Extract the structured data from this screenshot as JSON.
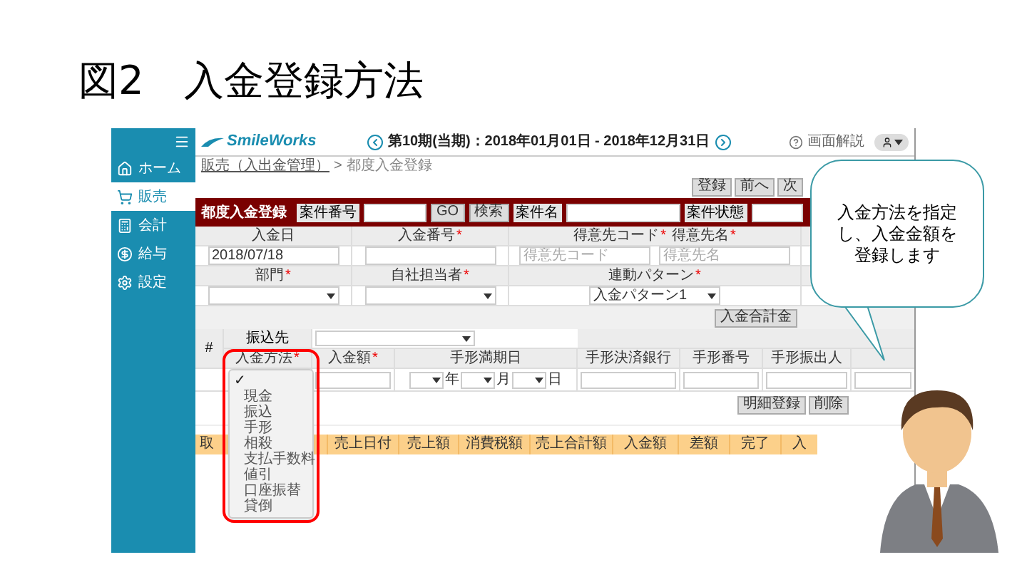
{
  "slide_title": "図2　入金登録方法",
  "required_mark": "*",
  "sidebar": {
    "items": [
      {
        "label": "ホーム",
        "selected": false
      },
      {
        "label": "販売",
        "selected": true
      },
      {
        "label": "会計",
        "selected": false
      },
      {
        "label": "給与",
        "selected": false
      },
      {
        "label": "設定",
        "selected": false
      }
    ]
  },
  "header": {
    "logo": "SmileWorks",
    "period": "第10期(当期)：2018年01月01日 - 2018年12月31日",
    "help": "画面解説"
  },
  "breadcrumb": {
    "link": "販売（入出金管理）",
    "separator": ">",
    "current": "都度入金登録"
  },
  "top_buttons": [
    "登録",
    "前へ",
    "次"
  ],
  "title_bar": {
    "title": "都度入金登録",
    "case_number_label": "案件番号",
    "go_button": "GO",
    "search_button": "検索",
    "case_name_label": "案件名",
    "case_status_label": "案件状態"
  },
  "form": {
    "rows": [
      {
        "cells": [
          {
            "labels": [
              {
                "text": "入金日",
                "required": false
              }
            ],
            "inputs": [
              {
                "kind": "text",
                "value": "2018/07/18"
              }
            ]
          },
          {
            "labels": [
              {
                "text": "入金番号",
                "required": true
              }
            ],
            "inputs": [
              {
                "kind": "text"
              }
            ]
          },
          {
            "labels": [
              {
                "text": "得意先コード",
                "required": true
              },
              {
                "text": "得意先名",
                "required": true
              }
            ],
            "inputs": [
              {
                "kind": "text",
                "placeholder": "得意先コード"
              },
              {
                "kind": "text",
                "placeholder": "得意先名"
              }
            ]
          }
        ]
      },
      {
        "cells": [
          {
            "labels": [
              {
                "text": "部門",
                "required": true
              }
            ],
            "inputs": [
              {
                "kind": "select"
              }
            ]
          },
          {
            "labels": [
              {
                "text": "自社担当者",
                "required": true
              }
            ],
            "inputs": [
              {
                "kind": "select"
              }
            ]
          },
          {
            "labels": [
              {
                "text": "連動パターン",
                "required": true
              }
            ],
            "inputs": [
              {
                "kind": "select",
                "value": "入金パターン1"
              }
            ]
          }
        ]
      }
    ]
  },
  "total_button": "入金合計金",
  "detail": {
    "index_header": "#",
    "payee_label": "振込先",
    "columns": [
      {
        "label": "入金方法",
        "required": true,
        "kind": "select"
      },
      {
        "label": "入金額",
        "required": true,
        "kind": "text"
      },
      {
        "label": "手形満期日",
        "required": false,
        "kind": "date",
        "units": [
          "年",
          "月",
          "日"
        ]
      },
      {
        "label": "手形決済銀行",
        "required": false,
        "kind": "text"
      },
      {
        "label": "手形番号",
        "required": false,
        "kind": "text"
      },
      {
        "label": "手形振出人",
        "required": false,
        "kind": "text"
      }
    ]
  },
  "dropdown": {
    "check_mark": "✓",
    "blank_selected": true,
    "options": [
      {
        "label": "現金",
        "selected": false
      },
      {
        "label": "振込",
        "selected": false
      },
      {
        "label": "手形",
        "selected": false
      },
      {
        "label": "相殺",
        "selected": false
      },
      {
        "label": "支払手数料",
        "selected": false
      },
      {
        "label": "値引",
        "selected": false
      },
      {
        "label": "口座振替",
        "selected": false
      },
      {
        "label": "貸倒",
        "selected": false
      }
    ]
  },
  "action_buttons": [
    "明細登録",
    "削除"
  ],
  "sales_table": {
    "columns": [
      "取",
      "売上日付",
      "売上額",
      "消費税額",
      "売上合計額",
      "入金額",
      "差額",
      "完了",
      "入"
    ]
  },
  "callout": "入金方法を指定し、入金金額を登録します"
}
